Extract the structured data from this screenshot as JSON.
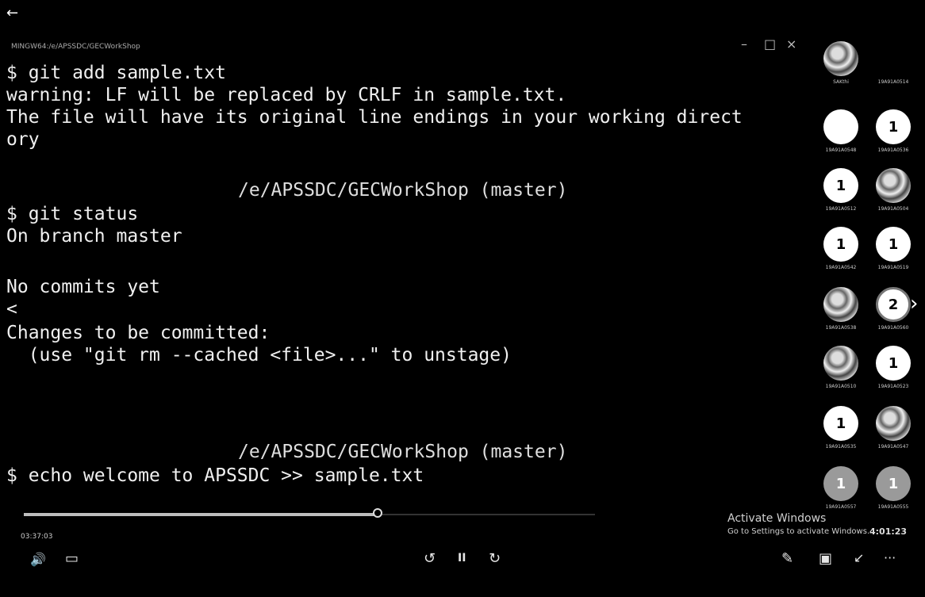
{
  "window": {
    "back_icon": "back-arrow-icon",
    "title": "MINGW64:/e/APSSDC/GECWorkShop",
    "controls": [
      "–",
      "□",
      "×"
    ]
  },
  "terminal": {
    "lines": [
      "$ git add sample.txt",
      "warning: LF will be replaced by CRLF in sample.txt.",
      "The file will have its original line endings in your working direct",
      "ory",
      "",
      "/e/APSSDC/GECWorkShop (master)",
      "$ git status",
      "On branch master",
      "",
      "No commits yet",
      "<",
      "Changes to be committed:",
      "  (use \"git rm --cached <file>...\" to unstage)",
      "",
      "",
      "",
      "/e/APSSDC/GECWorkShop (master)",
      "$ echo welcome to APSSDC >> sample.txt"
    ]
  },
  "participants": [
    {
      "label": "",
      "name": "SAKthi",
      "style": "photo"
    },
    {
      "label": "",
      "name": "19A91A0514",
      "style": "none"
    },
    {
      "label": "",
      "name": "19A91A0548",
      "style": "white"
    },
    {
      "label": "1",
      "name": "19A91A0536",
      "style": "white"
    },
    {
      "label": "1",
      "name": "19A91A0512",
      "style": "white"
    },
    {
      "label": "",
      "name": "19A91A0504",
      "style": "photo"
    },
    {
      "label": "1",
      "name": "19A91A0542",
      "style": "white"
    },
    {
      "label": "1",
      "name": "19A91A0519",
      "style": "white"
    },
    {
      "label": "",
      "name": "19A91A0538",
      "style": "photo"
    },
    {
      "label": "2",
      "name": "19A91A0560",
      "style": "outlined"
    },
    {
      "label": "",
      "name": "19A91A0510",
      "style": "photo"
    },
    {
      "label": "1",
      "name": "19A91A0523",
      "style": "white"
    },
    {
      "label": "1",
      "name": "19A91A0535",
      "style": "white"
    },
    {
      "label": "",
      "name": "19A91A0547",
      "style": "photo"
    },
    {
      "label": "1",
      "name": "19A91A0557",
      "style": "grey"
    },
    {
      "label": "1",
      "name": "19A91A0555",
      "style": "grey"
    }
  ],
  "player": {
    "elapsed": "03:37:03",
    "progress": 0.62,
    "controls": {
      "volume": "🔊",
      "captions": "▭",
      "rewind": "↺",
      "pause": "II",
      "forward": "↻",
      "pen": "✎",
      "screen": "▣",
      "minimize": "↙",
      "more": "···"
    }
  },
  "watermark": {
    "title": "Activate Windows",
    "subtitle": "Go to Settings to activate Windows."
  },
  "clock": "4:01:23"
}
